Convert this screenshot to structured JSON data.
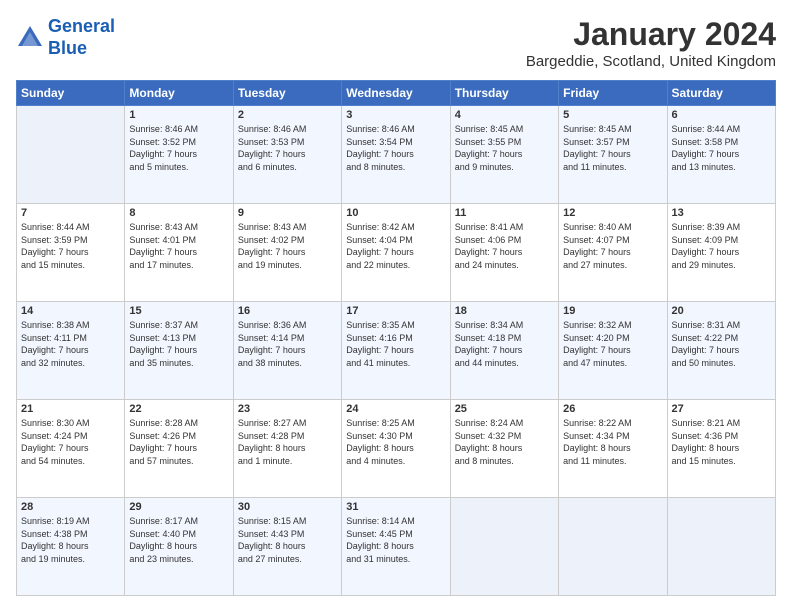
{
  "logo": {
    "line1": "General",
    "line2": "Blue"
  },
  "header": {
    "title": "January 2024",
    "subtitle": "Bargeddie, Scotland, United Kingdom"
  },
  "days_of_week": [
    "Sunday",
    "Monday",
    "Tuesday",
    "Wednesday",
    "Thursday",
    "Friday",
    "Saturday"
  ],
  "weeks": [
    [
      {
        "day": "",
        "info": ""
      },
      {
        "day": "1",
        "info": "Sunrise: 8:46 AM\nSunset: 3:52 PM\nDaylight: 7 hours\nand 5 minutes."
      },
      {
        "day": "2",
        "info": "Sunrise: 8:46 AM\nSunset: 3:53 PM\nDaylight: 7 hours\nand 6 minutes."
      },
      {
        "day": "3",
        "info": "Sunrise: 8:46 AM\nSunset: 3:54 PM\nDaylight: 7 hours\nand 8 minutes."
      },
      {
        "day": "4",
        "info": "Sunrise: 8:45 AM\nSunset: 3:55 PM\nDaylight: 7 hours\nand 9 minutes."
      },
      {
        "day": "5",
        "info": "Sunrise: 8:45 AM\nSunset: 3:57 PM\nDaylight: 7 hours\nand 11 minutes."
      },
      {
        "day": "6",
        "info": "Sunrise: 8:44 AM\nSunset: 3:58 PM\nDaylight: 7 hours\nand 13 minutes."
      }
    ],
    [
      {
        "day": "7",
        "info": "Sunrise: 8:44 AM\nSunset: 3:59 PM\nDaylight: 7 hours\nand 15 minutes."
      },
      {
        "day": "8",
        "info": "Sunrise: 8:43 AM\nSunset: 4:01 PM\nDaylight: 7 hours\nand 17 minutes."
      },
      {
        "day": "9",
        "info": "Sunrise: 8:43 AM\nSunset: 4:02 PM\nDaylight: 7 hours\nand 19 minutes."
      },
      {
        "day": "10",
        "info": "Sunrise: 8:42 AM\nSunset: 4:04 PM\nDaylight: 7 hours\nand 22 minutes."
      },
      {
        "day": "11",
        "info": "Sunrise: 8:41 AM\nSunset: 4:06 PM\nDaylight: 7 hours\nand 24 minutes."
      },
      {
        "day": "12",
        "info": "Sunrise: 8:40 AM\nSunset: 4:07 PM\nDaylight: 7 hours\nand 27 minutes."
      },
      {
        "day": "13",
        "info": "Sunrise: 8:39 AM\nSunset: 4:09 PM\nDaylight: 7 hours\nand 29 minutes."
      }
    ],
    [
      {
        "day": "14",
        "info": "Sunrise: 8:38 AM\nSunset: 4:11 PM\nDaylight: 7 hours\nand 32 minutes."
      },
      {
        "day": "15",
        "info": "Sunrise: 8:37 AM\nSunset: 4:13 PM\nDaylight: 7 hours\nand 35 minutes."
      },
      {
        "day": "16",
        "info": "Sunrise: 8:36 AM\nSunset: 4:14 PM\nDaylight: 7 hours\nand 38 minutes."
      },
      {
        "day": "17",
        "info": "Sunrise: 8:35 AM\nSunset: 4:16 PM\nDaylight: 7 hours\nand 41 minutes."
      },
      {
        "day": "18",
        "info": "Sunrise: 8:34 AM\nSunset: 4:18 PM\nDaylight: 7 hours\nand 44 minutes."
      },
      {
        "day": "19",
        "info": "Sunrise: 8:32 AM\nSunset: 4:20 PM\nDaylight: 7 hours\nand 47 minutes."
      },
      {
        "day": "20",
        "info": "Sunrise: 8:31 AM\nSunset: 4:22 PM\nDaylight: 7 hours\nand 50 minutes."
      }
    ],
    [
      {
        "day": "21",
        "info": "Sunrise: 8:30 AM\nSunset: 4:24 PM\nDaylight: 7 hours\nand 54 minutes."
      },
      {
        "day": "22",
        "info": "Sunrise: 8:28 AM\nSunset: 4:26 PM\nDaylight: 7 hours\nand 57 minutes."
      },
      {
        "day": "23",
        "info": "Sunrise: 8:27 AM\nSunset: 4:28 PM\nDaylight: 8 hours\nand 1 minute."
      },
      {
        "day": "24",
        "info": "Sunrise: 8:25 AM\nSunset: 4:30 PM\nDaylight: 8 hours\nand 4 minutes."
      },
      {
        "day": "25",
        "info": "Sunrise: 8:24 AM\nSunset: 4:32 PM\nDaylight: 8 hours\nand 8 minutes."
      },
      {
        "day": "26",
        "info": "Sunrise: 8:22 AM\nSunset: 4:34 PM\nDaylight: 8 hours\nand 11 minutes."
      },
      {
        "day": "27",
        "info": "Sunrise: 8:21 AM\nSunset: 4:36 PM\nDaylight: 8 hours\nand 15 minutes."
      }
    ],
    [
      {
        "day": "28",
        "info": "Sunrise: 8:19 AM\nSunset: 4:38 PM\nDaylight: 8 hours\nand 19 minutes."
      },
      {
        "day": "29",
        "info": "Sunrise: 8:17 AM\nSunset: 4:40 PM\nDaylight: 8 hours\nand 23 minutes."
      },
      {
        "day": "30",
        "info": "Sunrise: 8:15 AM\nSunset: 4:43 PM\nDaylight: 8 hours\nand 27 minutes."
      },
      {
        "day": "31",
        "info": "Sunrise: 8:14 AM\nSunset: 4:45 PM\nDaylight: 8 hours\nand 31 minutes."
      },
      {
        "day": "",
        "info": ""
      },
      {
        "day": "",
        "info": ""
      },
      {
        "day": "",
        "info": ""
      }
    ]
  ]
}
